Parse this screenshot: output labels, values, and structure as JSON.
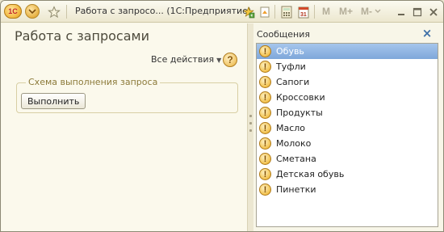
{
  "titlebar": {
    "logo": "1C",
    "window_title": "Работа с запросо... (1С:Предприятие)",
    "icons": [
      "menu-circle-icon",
      "star-icon",
      "favorites-icon",
      "history-icon",
      "calculator-icon",
      "calendar-icon"
    ],
    "memory_buttons": [
      "M",
      "M+",
      "M-"
    ],
    "window_buttons": [
      "minimize-icon",
      "maximize-icon",
      "close-icon"
    ]
  },
  "form": {
    "title": "Работа с запросами",
    "all_actions_label": "Все действия",
    "help_label": "?",
    "group_title": "Схема выполнения запроса",
    "execute_label": "Выполнить"
  },
  "messages": {
    "title": "Сообщения",
    "close_label": "×",
    "selected_index": 0,
    "items": [
      {
        "text": "Обувь"
      },
      {
        "text": "Туфли"
      },
      {
        "text": "Сапоги"
      },
      {
        "text": "Кроссовки"
      },
      {
        "text": "Продукты"
      },
      {
        "text": "Масло"
      },
      {
        "text": "Молоко"
      },
      {
        "text": "Сметана"
      },
      {
        "text": "Детская обувь"
      },
      {
        "text": "Пинетки"
      }
    ]
  },
  "colors": {
    "background": "#f8f6e8",
    "selection": "#7ea7da",
    "accent_title": "#4d4a3c",
    "group_title": "#8c7a3a"
  }
}
